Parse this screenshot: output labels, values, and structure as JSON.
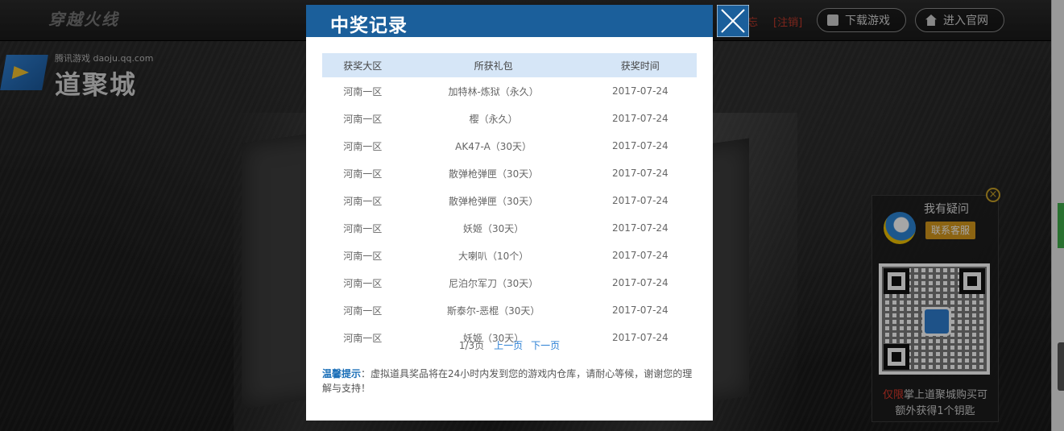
{
  "background": {
    "game_logo": "穿越火线",
    "top_links": {
      "register_partial": "忘",
      "logout": "[注销]"
    },
    "top_buttons": [
      {
        "label": "下载游戏",
        "icon": "download-icon"
      },
      {
        "label": "进入官网",
        "icon": "home-icon"
      }
    ],
    "daoju": {
      "site": "腾讯游戏 daoju.qq.com",
      "name": "道聚城"
    }
  },
  "service_panel": {
    "title": "我有疑问",
    "button": "联系客服",
    "footer_highlight": "仅限",
    "footer_text_1": "掌上道聚城购买可",
    "footer_text_2": "额外获得1个钥匙"
  },
  "modal": {
    "title": "中奖记录",
    "columns": [
      "获奖大区",
      "所获礼包",
      "获奖时间"
    ],
    "rows": [
      {
        "area": "河南一区",
        "gift": "加特林-炼狱（永久）",
        "time": "2017-07-24"
      },
      {
        "area": "河南一区",
        "gift": "樱（永久）",
        "time": "2017-07-24"
      },
      {
        "area": "河南一区",
        "gift": "AK47-A（30天）",
        "time": "2017-07-24"
      },
      {
        "area": "河南一区",
        "gift": "散弹枪弹匣（30天）",
        "time": "2017-07-24"
      },
      {
        "area": "河南一区",
        "gift": "散弹枪弹匣（30天）",
        "time": "2017-07-24"
      },
      {
        "area": "河南一区",
        "gift": "妖姬（30天）",
        "time": "2017-07-24"
      },
      {
        "area": "河南一区",
        "gift": "大喇叭（10个）",
        "time": "2017-07-24"
      },
      {
        "area": "河南一区",
        "gift": "尼泊尔军刀（30天）",
        "time": "2017-07-24"
      },
      {
        "area": "河南一区",
        "gift": "斯泰尔-恶棍（30天）",
        "time": "2017-07-24"
      },
      {
        "area": "河南一区",
        "gift": "妖姬（30天）",
        "time": "2017-07-24"
      }
    ],
    "pager": {
      "page_info": "1/3页",
      "prev": "上一页",
      "next": "下一页"
    },
    "tip": {
      "label": "温馨提示",
      "text": "：虚拟道具奖品将在24小时内发到您的游戏内仓库，请耐心等候，谢谢您的理解与支持！"
    }
  },
  "colors": {
    "header_blue": "#1b5f9b",
    "table_header": "#d6e6f7",
    "link_blue": "#2a7fd4",
    "accent_red": "#e0392b"
  }
}
